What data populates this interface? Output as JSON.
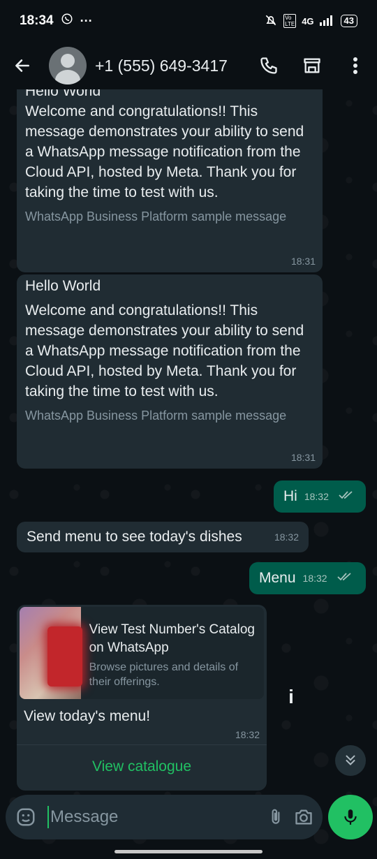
{
  "status_bar": {
    "time": "18:34",
    "signal": "4G",
    "battery": "43"
  },
  "header": {
    "contact": "+1 (555) 649-3417"
  },
  "messages": {
    "template1": {
      "title": "Hello World",
      "body": "Welcome and congratulations!! This message demonstrates your ability to send a WhatsApp message notification from the Cloud API, hosted by Meta. Thank you for taking the time to test with us.",
      "footer": "WhatsApp Business Platform sample message",
      "time": "18:31"
    },
    "template2": {
      "title": "Hello World",
      "body": "Welcome and congratulations!! This message demonstrates your ability to send a WhatsApp message notification from the Cloud API, hosted by Meta. Thank you for taking the time to test with us.",
      "footer": "WhatsApp Business Platform sample message",
      "time": "18:31"
    },
    "hi": {
      "text": "Hi",
      "time": "18:32"
    },
    "send_menu": {
      "text": "Send menu to see today's dishes",
      "time": "18:32"
    },
    "menu": {
      "text": "Menu",
      "time": "18:32"
    },
    "catalog": {
      "card_title": "View Test Number's Catalog on WhatsApp",
      "card_desc": "Browse pictures and details of their offerings.",
      "text": "View today's menu!",
      "time": "18:32",
      "button": "View catalogue"
    }
  },
  "composer": {
    "placeholder": "Message"
  },
  "colors": {
    "accent": "#21c063",
    "incoming_bubble": "#202c33",
    "outgoing_bubble": "#005c4b",
    "background": "#0b1014"
  }
}
